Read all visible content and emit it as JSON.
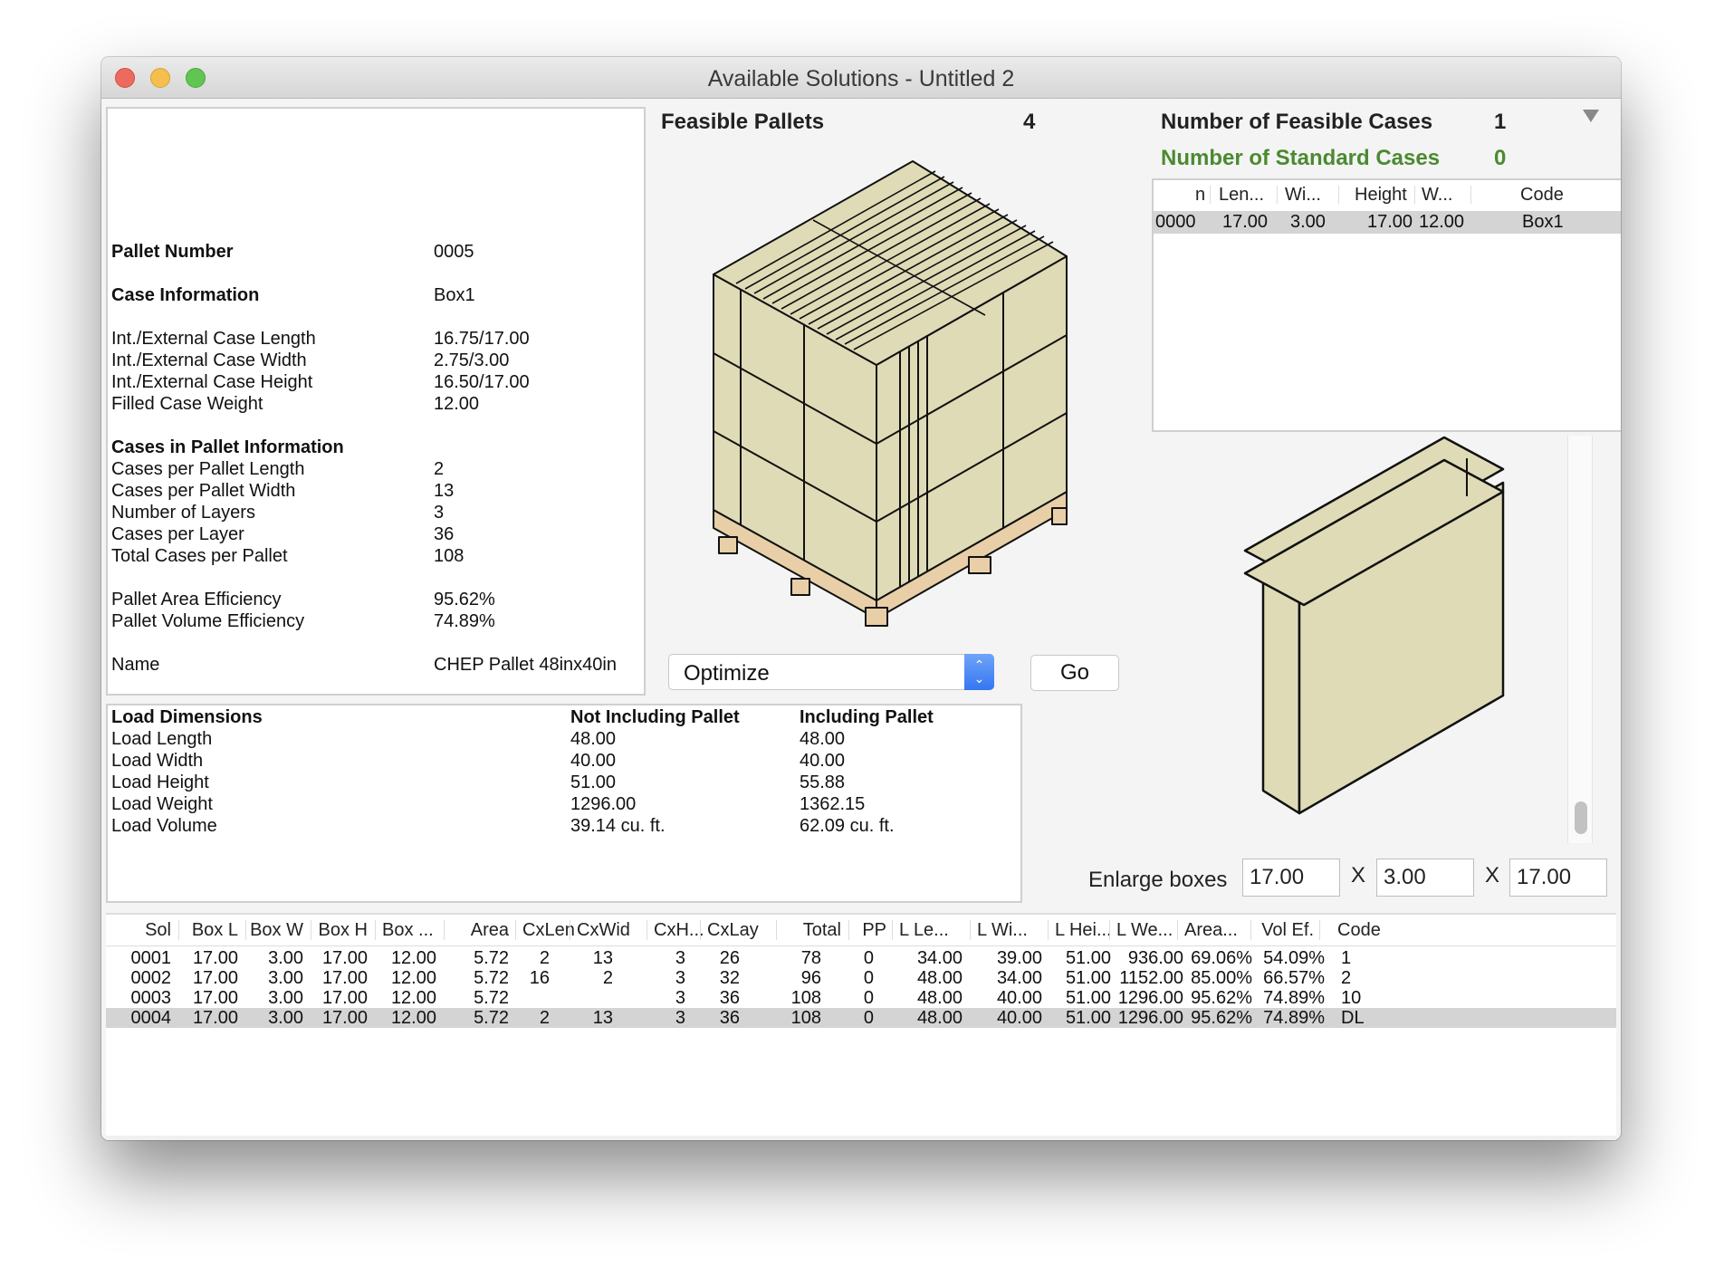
{
  "window": {
    "title": "Available Solutions - Untitled 2"
  },
  "info": {
    "pallet_number_label": "Pallet Number",
    "pallet_number": "0005",
    "case_info_label": "Case Information",
    "case_info": "Box1",
    "rows_case": [
      {
        "label": "Int./External Case Length",
        "value": "16.75/17.00"
      },
      {
        "label": "Int./External Case Width",
        "value": "2.75/3.00"
      },
      {
        "label": "Int./External Case Height",
        "value": "16.50/17.00"
      },
      {
        "label": "Filled Case Weight",
        "value": "12.00"
      }
    ],
    "cases_in_pallet_label": "Cases in Pallet Information",
    "rows_pallet": [
      {
        "label": "Cases per Pallet Length",
        "value": "2"
      },
      {
        "label": "Cases per Pallet Width",
        "value": "13"
      },
      {
        "label": "Number of Layers",
        "value": "3"
      },
      {
        "label": "Cases per Layer",
        "value": "36"
      },
      {
        "label": "Total Cases per Pallet",
        "value": "108"
      }
    ],
    "rows_eff": [
      {
        "label": "Pallet Area Efficiency",
        "value": "95.62%"
      },
      {
        "label": "Pallet Volume Efficiency",
        "value": "74.89%"
      }
    ],
    "name_label": "Name",
    "name": "CHEP Pallet 48inx40in"
  },
  "feasible": {
    "pallets_label": "Feasible Pallets",
    "pallets_count": "4",
    "cases_label": "Number of Feasible Cases",
    "cases_count": "1",
    "standard_label": "Number of Standard Cases",
    "standard_count": "0"
  },
  "colors": {
    "case_fill": "#dfdbb6",
    "pallet_fill": "#e8cfa8",
    "standard_green": "#4b8a30",
    "selection": "#d4d4d4",
    "accent_blue": "#3576f2"
  },
  "controls": {
    "mode_select": "Optimize",
    "go_label": "Go",
    "enlarge_label": "Enlarge boxes",
    "enlarge_l": "17.00",
    "enlarge_w": "3.00",
    "enlarge_h": "17.00",
    "x_sep": "X"
  },
  "load": {
    "headers": [
      "Load Dimensions",
      "Not Including Pallet",
      "Including Pallet"
    ],
    "rows": [
      [
        "Load Length",
        "48.00",
        "48.00"
      ],
      [
        "Load Width",
        "40.00",
        "40.00"
      ],
      [
        "Load Height",
        "51.00",
        "55.88"
      ],
      [
        "Load Weight",
        "1296.00",
        "1362.15"
      ],
      [
        "Load Volume",
        "39.14 cu. ft.",
        "62.09 cu. ft."
      ]
    ]
  },
  "cases_table": {
    "headers": [
      "n",
      "Len...",
      "Wi...",
      "Height",
      "W...",
      "Code"
    ],
    "rows": [
      [
        "0000",
        "17.00",
        "3.00",
        "17.00",
        "12.00",
        "Box1"
      ]
    ],
    "selected_index": 0
  },
  "solutions": {
    "headers": [
      "Sol",
      "Box L",
      "Box W",
      "Box H",
      "Box ...",
      "Area",
      "CxLen",
      "CxWid",
      "CxH...",
      "CxLay",
      "Total",
      "PP",
      "L Le...",
      "L Wi...",
      "L Hei...",
      "L We...",
      "Area...",
      "Vol Ef.",
      "Code"
    ],
    "rows": [
      [
        "0001",
        "17.00",
        "3.00",
        "17.00",
        "12.00",
        "5.72",
        "2",
        "13",
        "3",
        "26",
        "78",
        "0",
        "34.00",
        "39.00",
        "51.00",
        "936.00",
        "69.06%",
        "54.09%",
        "1"
      ],
      [
        "0002",
        "17.00",
        "3.00",
        "17.00",
        "12.00",
        "5.72",
        "16",
        "2",
        "3",
        "32",
        "96",
        "0",
        "48.00",
        "34.00",
        "51.00",
        "1152.00",
        "85.00%",
        "66.57%",
        "2"
      ],
      [
        "0003",
        "17.00",
        "3.00",
        "17.00",
        "12.00",
        "5.72",
        "",
        "",
        "3",
        "36",
        "108",
        "0",
        "48.00",
        "40.00",
        "51.00",
        "1296.00",
        "95.62%",
        "74.89%",
        "10"
      ],
      [
        "0004",
        "17.00",
        "3.00",
        "17.00",
        "12.00",
        "5.72",
        "2",
        "13",
        "3",
        "36",
        "108",
        "0",
        "48.00",
        "40.00",
        "51.00",
        "1296.00",
        "95.62%",
        "74.89%",
        "DL"
      ]
    ],
    "selected_index": 3
  }
}
